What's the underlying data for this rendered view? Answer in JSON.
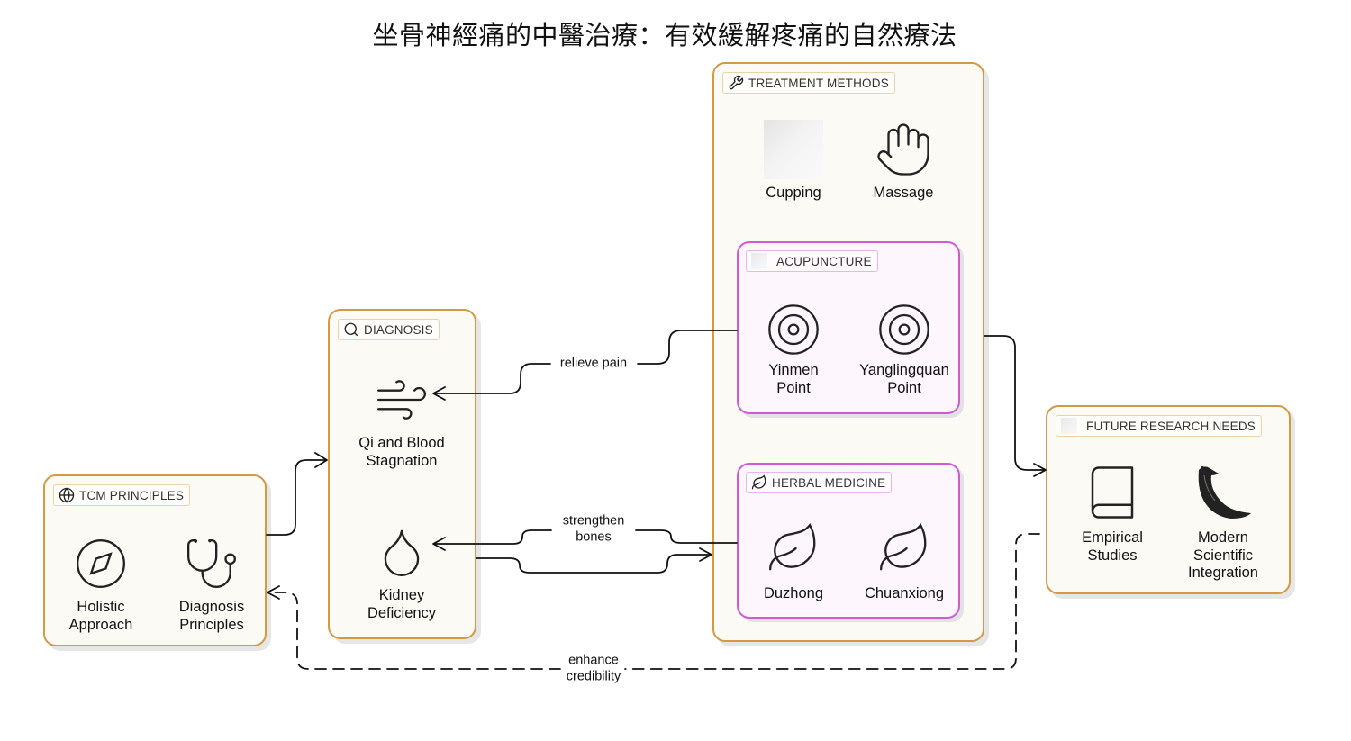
{
  "title": "坐骨神經痛的中醫治療：有效緩解疼痛的自然療法",
  "colors": {
    "group_border": "#d19a44",
    "group_fill": "#fcfaf5",
    "subgroup_border": "#d05ad6",
    "subgroup_fill": "#fdf6fd",
    "edge": "#111111"
  },
  "groups": {
    "tcm": {
      "label": "TCM PRINCIPLES",
      "icon": "globe-icon",
      "nodes": [
        {
          "icon": "compass-icon",
          "line1": "Holistic",
          "line2": "Approach"
        },
        {
          "icon": "stethoscope-icon",
          "line1": "Diagnosis",
          "line2": "Principles"
        }
      ]
    },
    "diagnosis": {
      "label": "DIAGNOSIS",
      "icon": "search-icon",
      "nodes": [
        {
          "icon": "wind-icon",
          "line1": "Qi and Blood",
          "line2": "Stagnation"
        },
        {
          "icon": "droplet-icon",
          "line1": "Kidney",
          "line2": "Deficiency"
        }
      ]
    },
    "treatment": {
      "label": "TREATMENT METHODS",
      "icon": "wrench-icon",
      "nodes": [
        {
          "icon": "image-placeholder",
          "line1": "Cupping"
        },
        {
          "icon": "hand-icon",
          "line1": "Massage"
        }
      ],
      "subgroups": {
        "acupuncture": {
          "label": "ACUPUNCTURE",
          "icon": "image-placeholder",
          "nodes": [
            {
              "icon": "target-icon",
              "line1": "Yinmen",
              "line2": "Point"
            },
            {
              "icon": "target-icon",
              "line1": "Yanglingquan",
              "line2": "Point"
            }
          ]
        },
        "herbal": {
          "label": "HERBAL MEDICINE",
          "icon": "leaf-icon",
          "nodes": [
            {
              "icon": "leaf-icon",
              "line1": "Duzhong"
            },
            {
              "icon": "leaf-icon",
              "line1": "Chuanxiong"
            }
          ]
        }
      }
    },
    "research": {
      "label": "FUTURE RESEARCH NEEDS",
      "icon": "image-placeholder",
      "nodes": [
        {
          "icon": "book-icon",
          "line1": "Empirical",
          "line2": "Studies"
        },
        {
          "icon": "horn-icon",
          "line1": "Modern",
          "line2": "Scientific",
          "line3": "Integration"
        }
      ]
    }
  },
  "edges": [
    {
      "from": "TCM PRINCIPLES",
      "to": "DIAGNOSIS",
      "label": "",
      "style": "solid"
    },
    {
      "from": "ACUPUNCTURE",
      "to": "Qi and Blood Stagnation",
      "label": "relieve pain",
      "style": "solid"
    },
    {
      "from": "HERBAL MEDICINE",
      "to": "Kidney Deficiency",
      "label_line1": "strengthen",
      "label_line2": "bones",
      "style": "solid"
    },
    {
      "from": "DIAGNOSIS",
      "to": "TREATMENT METHODS",
      "label": "",
      "style": "solid"
    },
    {
      "from": "TREATMENT METHODS",
      "to": "FUTURE RESEARCH NEEDS",
      "label": "",
      "style": "solid"
    },
    {
      "from": "FUTURE RESEARCH NEEDS",
      "to": "TCM PRINCIPLES",
      "label_line1": "enhance",
      "label_line2": "credibility",
      "style": "dashed"
    }
  ]
}
